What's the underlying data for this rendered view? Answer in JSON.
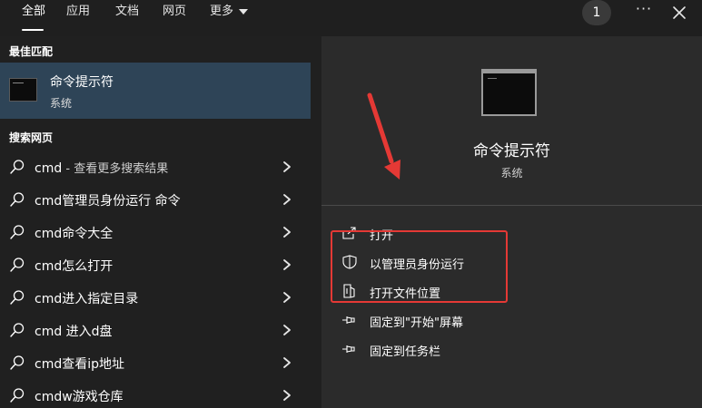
{
  "tabs": [
    {
      "label": "全部",
      "active": true
    },
    {
      "label": "应用"
    },
    {
      "label": "文档"
    },
    {
      "label": "网页"
    },
    {
      "label": "更多"
    }
  ],
  "badge_count": "1",
  "ellipsis": "···",
  "left": {
    "best_match_title": "最佳匹配",
    "best_match": {
      "title": "命令提示符",
      "subtitle": "系统"
    },
    "web_title": "搜索网页",
    "web_results": [
      {
        "bold": "cmd",
        "muted": " - 查看更多搜索结果"
      },
      {
        "bold": "cmd管理员身份运行 命令",
        "muted": ""
      },
      {
        "bold": "cmd命令大全",
        "muted": ""
      },
      {
        "bold": "cmd怎么打开",
        "muted": ""
      },
      {
        "bold": "cmd进入指定目录",
        "muted": ""
      },
      {
        "bold": "cmd 进入d盘",
        "muted": ""
      },
      {
        "bold": "cmd查看ip地址",
        "muted": ""
      },
      {
        "bold": "cmdw游戏仓库",
        "muted": ""
      }
    ]
  },
  "right": {
    "app_title": "命令提示符",
    "app_subtitle": "系统",
    "actions": [
      {
        "label": "打开",
        "icon": "open-icon"
      },
      {
        "label": "以管理员身份运行",
        "icon": "shield-icon"
      },
      {
        "label": "打开文件位置",
        "icon": "folder-icon"
      },
      {
        "label": "固定到\"开始\"屏幕",
        "icon": "pin-icon"
      },
      {
        "label": "固定到任务栏",
        "icon": "pin-icon"
      }
    ]
  },
  "colors": {
    "background": "#202020",
    "panel": "#2b2b2b",
    "selected": "#2e4457",
    "annotation_red": "#e53935"
  }
}
